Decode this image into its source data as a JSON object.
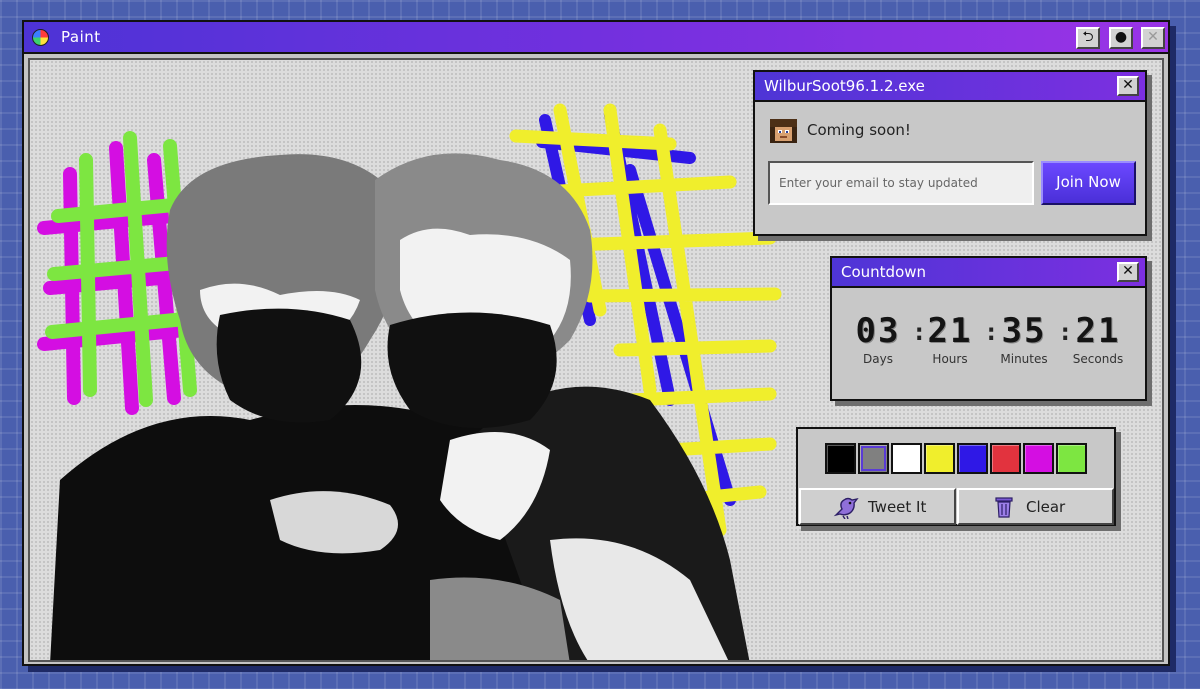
{
  "window": {
    "title": "Paint",
    "buttons": {
      "restore": "⮌",
      "record": "●",
      "close": "✕"
    }
  },
  "signup": {
    "title": "WilburSoot96.1.2.exe",
    "close": "✕",
    "status": "Coming soon!",
    "email_placeholder": "Enter your email to stay updated",
    "join_label": "Join Now"
  },
  "countdown": {
    "title": "Countdown",
    "close": "✕",
    "units": [
      {
        "value": "03",
        "label": "Days"
      },
      {
        "value": "21",
        "label": "Hours"
      },
      {
        "value": "35",
        "label": "Minutes"
      },
      {
        "value": "21",
        "label": "Seconds"
      }
    ],
    "separator": ":"
  },
  "palette": {
    "colors": [
      "#000000",
      "#808080",
      "#ffffff",
      "#f0ee2c",
      "#2f18e6",
      "#e2333e",
      "#d40ee2",
      "#7de641"
    ],
    "selected_index": 1,
    "tweet_label": "Tweet It",
    "clear_label": "Clear"
  }
}
